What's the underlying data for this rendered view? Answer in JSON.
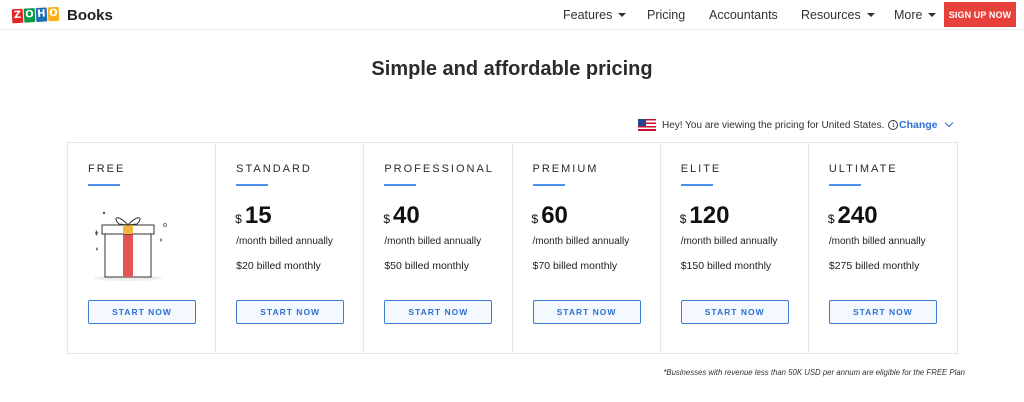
{
  "header": {
    "logo_letters": [
      "Z",
      "O",
      "H",
      "O"
    ],
    "logo_colors": [
      "#e42527",
      "#089949",
      "#226db4",
      "#f9b21d"
    ],
    "logo_text": "Books",
    "nav": [
      {
        "label": "Features",
        "has_caret": true
      },
      {
        "label": "Pricing",
        "has_caret": false
      },
      {
        "label": "Accountants",
        "has_caret": false
      },
      {
        "label": "Resources",
        "has_caret": true
      },
      {
        "label": "More",
        "has_caret": true
      }
    ],
    "signup_label": "SIGN UP NOW",
    "signup_color": "#e8413c"
  },
  "page_title": "Simple and affordable pricing",
  "region": {
    "flag_icon": "us-flag-icon",
    "text": "Hey! You are viewing the pricing for United States.",
    "change_label": "Change"
  },
  "plans": [
    {
      "name": "FREE",
      "currency": "",
      "price": "",
      "per": "",
      "monthly": "",
      "button": "START NOW"
    },
    {
      "name": "STANDARD",
      "currency": "$",
      "price": "15",
      "per": "/month billed annually",
      "monthly": "$20 billed monthly",
      "button": "START NOW"
    },
    {
      "name": "PROFESSIONAL",
      "currency": "$",
      "price": "40",
      "per": "/month billed annually",
      "monthly": "$50 billed monthly",
      "button": "START NOW"
    },
    {
      "name": "PREMIUM",
      "currency": "$",
      "price": "60",
      "per": "/month billed annually",
      "monthly": "$70 billed monthly",
      "button": "START NOW"
    },
    {
      "name": "ELITE",
      "currency": "$",
      "price": "120",
      "per": "/month billed annually",
      "monthly": "$150 billed monthly",
      "button": "START NOW"
    },
    {
      "name": "ULTIMATE",
      "currency": "$",
      "price": "240",
      "per": "/month billed annually",
      "monthly": "$275 billed monthly",
      "button": "START NOW"
    }
  ],
  "accent_color": "#2f6fd6",
  "footnote": "*Businesses with revenue less than 50K USD per annum are eligible for the FREE Plan"
}
